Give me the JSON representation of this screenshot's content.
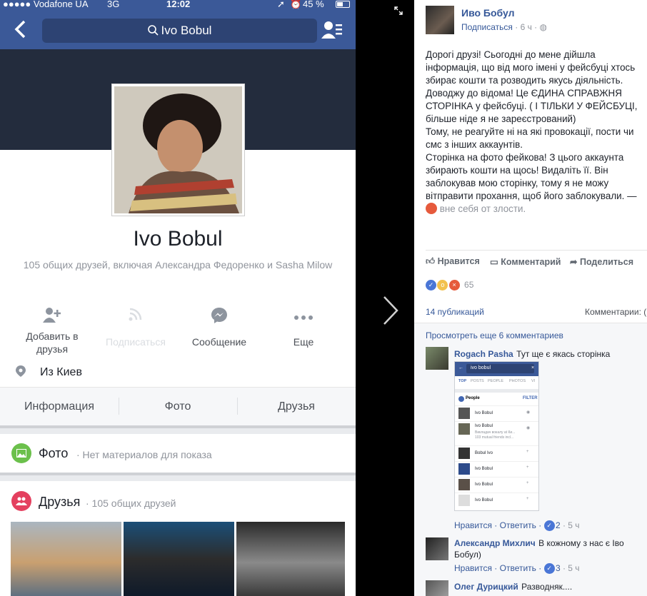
{
  "phone": {
    "status": {
      "carrier": "●●●●● Vodafone UA",
      "network": "3G",
      "time": "12:02",
      "battery": "45 %"
    },
    "search": {
      "query": "Ivo Bobul"
    },
    "profile": {
      "name": "Ivo Bobul",
      "mutual": "105 общих друзей, включая Александра Федоренко и Sasha Milow"
    },
    "actions": [
      {
        "label": "Добавить в друзья"
      },
      {
        "label": "Подписаться"
      },
      {
        "label": "Сообщение"
      },
      {
        "label": "Еще"
      }
    ],
    "location": "Из Киев",
    "tabs": [
      "Информация",
      "Фото",
      "Друзья"
    ],
    "photos_section": {
      "title": "Фото",
      "subtitle": "· Нет материалов для показа"
    },
    "friends_section": {
      "title": "Друзья",
      "subtitle": "· 105 общих друзей"
    }
  },
  "post": {
    "author": "Иво Бобул",
    "follow": "Подписаться",
    "time": "· 6 ч ·",
    "text": [
      "Дорогі друзі! Сьогодні до мене дійшла",
      "інформація, що від мого імені у фейсбуці хтось",
      "збирає кошти та розводить якусь діяльність.",
      "Доводжу до відома! Це ЄДИНА СПРАВЖНЯ",
      "СТОРІНКА у фейсбуці. ( І ТІЛЬКИ У ФЕЙСБУЦІ,",
      "більше ніде я не зареєстрований)",
      "Тому, не реагуйте ні на які провокації, пости чи",
      "смс з інших аккаунтів.",
      "Сторінка на фото фейкова! З цього аккаунта",
      "збирають кошти на щось! Видаліть її. Він",
      "заблокував мою сторінку, тому я не можу",
      "вітправити прохання, щоб його заблокували. —"
    ],
    "feeling": "вне себя от злости.",
    "like": "Нравится",
    "comment": "Комментарий",
    "share": "Поделиться",
    "reactions_count": "65",
    "shares": "14 публикаций",
    "comments_label": "Комментарии: (",
    "more_comments": "Просмотреть еще 6 комментариев",
    "comments": [
      {
        "name": "Rogach Pasha",
        "text": "Тут ще є якась сторінка",
        "like": "Нравится",
        "reply": "Ответить",
        "count": "2",
        "time": "· 5 ч"
      },
      {
        "name": "Александр Михлич",
        "text": "В кожному з нас є Іво Бобул)",
        "like": "Нравится",
        "reply": "Ответить",
        "count": "3",
        "time": "· 5 ч"
      },
      {
        "name": "Олег Дурицкий",
        "text": "Разводняк...."
      }
    ],
    "mini": {
      "query": "ivo bobul",
      "tabs": [
        "TOP",
        "POSTS",
        "PEOPLE",
        "PHOTOS",
        "VI"
      ],
      "people": "People",
      "filter": "FILTER",
      "rows": [
        "Ivo Bobul",
        "Ivo  Bobul",
        "Bobul Ivo",
        "Ivo Bobul",
        "Ivo Bobul",
        "Ivo Bobul"
      ],
      "row2_sub": "Викладач вокалу at Ки...",
      "row2_sub2": "103 mutual friends incl..."
    }
  }
}
